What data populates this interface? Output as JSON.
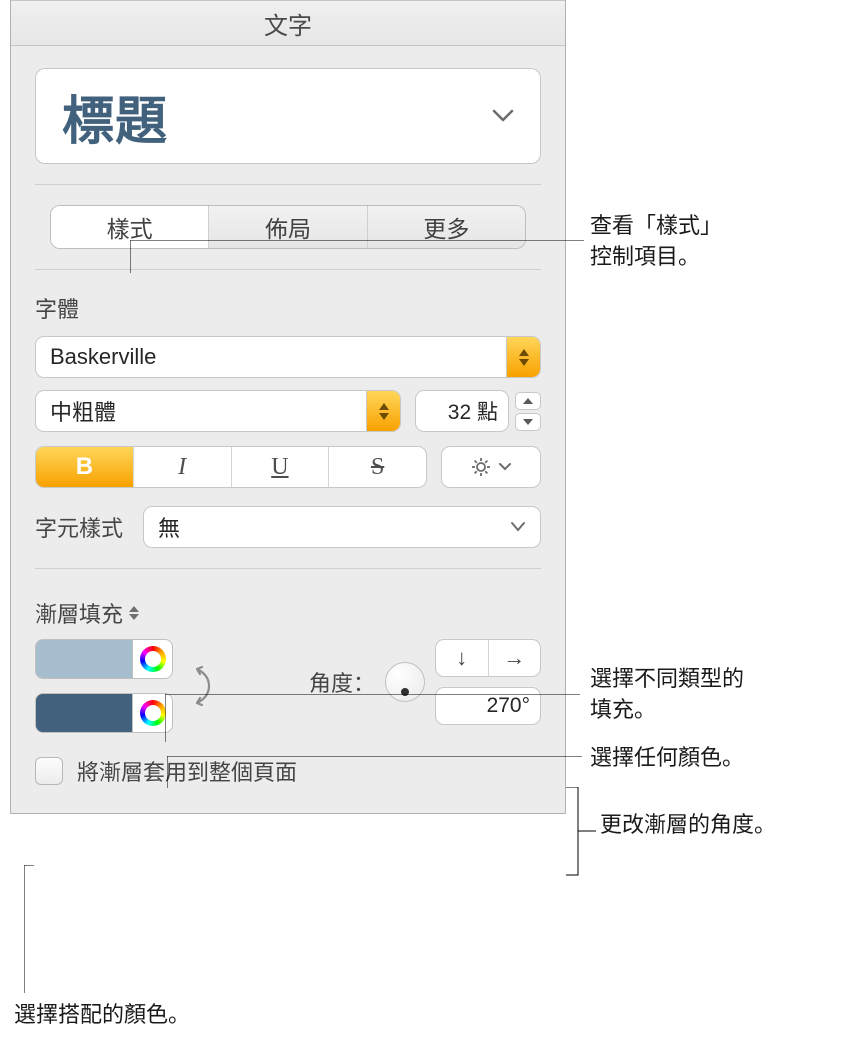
{
  "panel_title": "文字",
  "style_name": "標題",
  "tabs": {
    "style": "樣式",
    "layout": "佈局",
    "more": "更多"
  },
  "font_label": "字體",
  "font_family": "Baskerville",
  "font_weight": "中粗體",
  "font_size": "32 點",
  "char_style_label": "字元樣式",
  "char_style_value": "無",
  "fill_label": "漸層填充",
  "angle_label": "角度：",
  "angle_value": "270°",
  "apply_page_label": "將漸層套用到整個頁面",
  "callouts": {
    "c1a": "查看「樣式」",
    "c1b": "控制項目。",
    "c2a": "選擇不同類型的",
    "c2b": "填充。",
    "c3": "選擇任何顏色。",
    "c4": "更改漸層的角度。",
    "c5": "選擇搭配的顏色。"
  },
  "colors": {
    "swatch1": "#a6bdce",
    "swatch2": "#41617d",
    "accent": "#f8a100"
  }
}
